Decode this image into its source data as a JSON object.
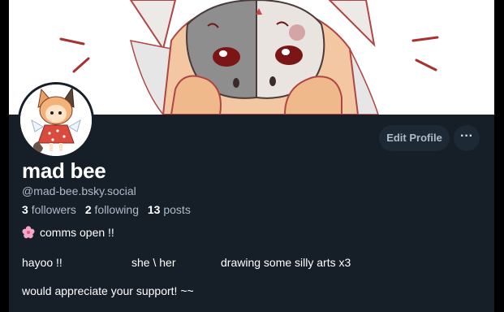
{
  "profile": {
    "display_name": "mad bee",
    "handle": "@mad-bee.bsky.social",
    "edit_profile_label": "Edit Profile",
    "more_label": "···"
  },
  "stats": {
    "followers_count": "3",
    "followers_label": "followers",
    "following_count": "2",
    "following_label": "following",
    "posts_count": "13",
    "posts_label": "posts"
  },
  "bio": {
    "line1": "comms open !!",
    "line1_icon": "cherry-blossom-icon",
    "line2_parts": [
      "hayoo !!",
      "she \\ her",
      "drawing some silly arts x3"
    ],
    "line3": "would appreciate your support! ~~"
  },
  "colors": {
    "background": "#161e27",
    "button_bg": "#1e2936",
    "muted_text": "#aebbc9",
    "text": "#ffffff"
  }
}
